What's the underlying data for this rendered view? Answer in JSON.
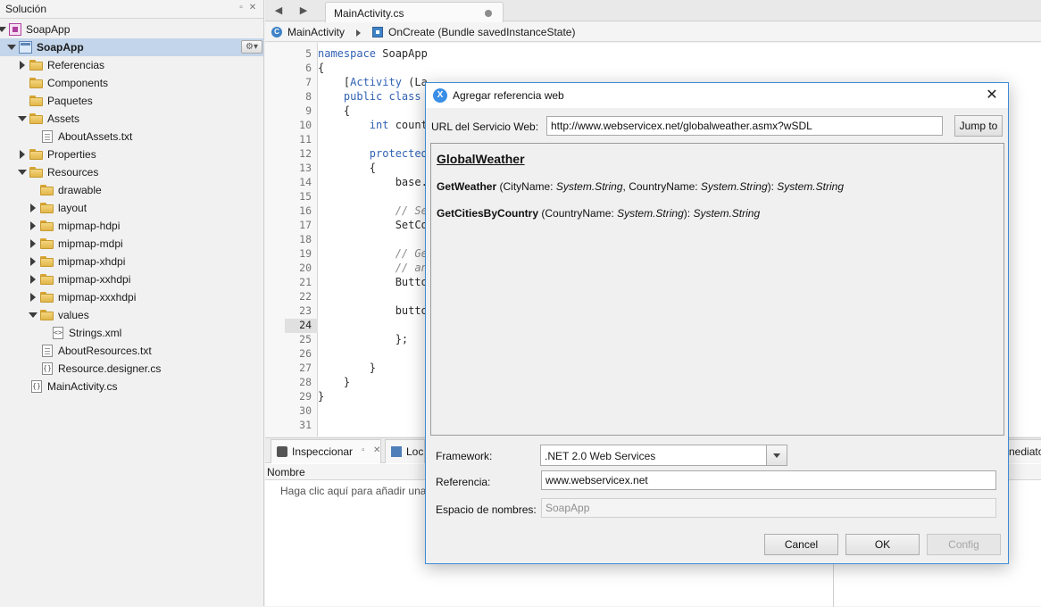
{
  "solution": {
    "title": "Solución",
    "items": [
      {
        "label": "SoapApp"
      },
      {
        "label": "SoapApp"
      },
      {
        "label": "Referencias"
      },
      {
        "label": "Components"
      },
      {
        "label": "Paquetes"
      },
      {
        "label": "Assets"
      },
      {
        "label": "AboutAssets.txt"
      },
      {
        "label": "Properties"
      },
      {
        "label": "Resources"
      },
      {
        "label": "drawable"
      },
      {
        "label": "layout"
      },
      {
        "label": "mipmap-hdpi"
      },
      {
        "label": "mipmap-mdpi"
      },
      {
        "label": "mipmap-xhdpi"
      },
      {
        "label": "mipmap-xxhdpi"
      },
      {
        "label": "mipmap-xxxhdpi"
      },
      {
        "label": "values"
      },
      {
        "label": "Strings.xml"
      },
      {
        "label": "AboutResources.txt"
      },
      {
        "label": "Resource.designer.cs"
      },
      {
        "label": "MainActivity.cs"
      }
    ]
  },
  "editor": {
    "tab_label": "MainActivity.cs",
    "breadcrumb": {
      "class": "MainActivity",
      "method": "OnCreate (Bundle savedInstanceState)"
    },
    "lines": [
      {
        "num": "5",
        "code": "namespace SoapApp"
      },
      {
        "num": "6",
        "code": "{"
      },
      {
        "num": "7",
        "code": "    [Activity (La"
      },
      {
        "num": "8",
        "code": "    public class "
      },
      {
        "num": "9",
        "code": "    {"
      },
      {
        "num": "10",
        "code": "        int count"
      },
      {
        "num": "11",
        "code": ""
      },
      {
        "num": "12",
        "code": "        protected"
      },
      {
        "num": "13",
        "code": "        {"
      },
      {
        "num": "14",
        "code": "            base."
      },
      {
        "num": "15",
        "code": ""
      },
      {
        "num": "16",
        "code": "            // Se"
      },
      {
        "num": "17",
        "code": "            SetCo"
      },
      {
        "num": "18",
        "code": ""
      },
      {
        "num": "19",
        "code": "            // Ge"
      },
      {
        "num": "20",
        "code": "            // an"
      },
      {
        "num": "21",
        "code": "            Butto"
      },
      {
        "num": "22",
        "code": ""
      },
      {
        "num": "23",
        "code": "            butto"
      },
      {
        "num": "24",
        "code": ""
      },
      {
        "num": "25",
        "code": "            };"
      },
      {
        "num": "26",
        "code": ""
      },
      {
        "num": "27",
        "code": "        }"
      },
      {
        "num": "28",
        "code": "    }"
      },
      {
        "num": "29",
        "code": "}"
      },
      {
        "num": "30",
        "code": ""
      },
      {
        "num": "31",
        "code": ""
      }
    ]
  },
  "bottom": {
    "tab_inspect": "Inspeccionar",
    "tab_locals": "Loc",
    "tab_immediate": "nediato",
    "column_name": "Nombre",
    "hint": "Haga clic aquí para añadir una"
  },
  "dialog": {
    "title": "Agregar referencia web",
    "url_label": "URL del Servicio Web:",
    "url_value": "http://www.webservicex.net/globalweather.asmx?wSDL",
    "jump_button": "Jump to",
    "service_name": "GlobalWeather",
    "methods": [
      {
        "name": "GetWeather",
        "p1": "CityName",
        "t1": "System.String",
        "p2": "CountryName",
        "t2": "System.String",
        "ret": "System.String"
      },
      {
        "name": "GetCitiesByCountry",
        "p1": "CountryName",
        "t1": "System.String",
        "ret": "System.String"
      }
    ],
    "framework_label": "Framework:",
    "framework_value": ".NET 2.0 Web Services",
    "reference_label": "Referencia:",
    "reference_value": "www.webservicex.net",
    "namespace_label": "Espacio de nombres:",
    "namespace_value": "SoapApp",
    "cancel_button": "Cancel",
    "ok_button": "OK",
    "config_button": "Config"
  },
  "colors": {
    "selection": "#c3d5ea",
    "keyword": "#3262b4",
    "dialog_border": "#3c8bd6"
  }
}
